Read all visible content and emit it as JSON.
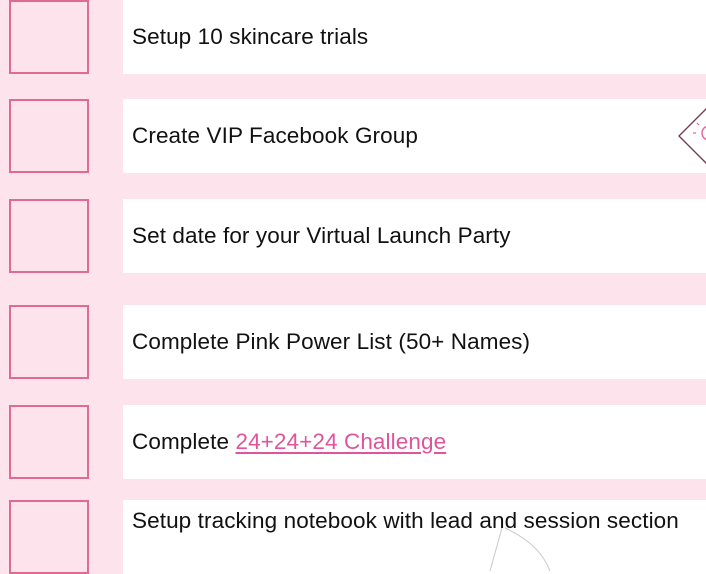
{
  "checklist": {
    "tasks": [
      {
        "label": "Setup 10 skincare trials"
      },
      {
        "label": "Create VIP Facebook Group"
      },
      {
        "label": "Set date for your Virtual Launch Party"
      },
      {
        "label": "Complete Pink Power List (50+ Names)"
      },
      {
        "label": "Complete ",
        "link": "24+24+24 Challenge"
      },
      {
        "label": "Setup tracking notebook with lead and session section"
      }
    ]
  },
  "icons": {
    "idea": "lightbulb-diamond-icon"
  },
  "colors": {
    "background": "#fde3ec",
    "checkbox_border": "#e06a92",
    "link": "#e0559a",
    "task_background": "#ffffff"
  }
}
